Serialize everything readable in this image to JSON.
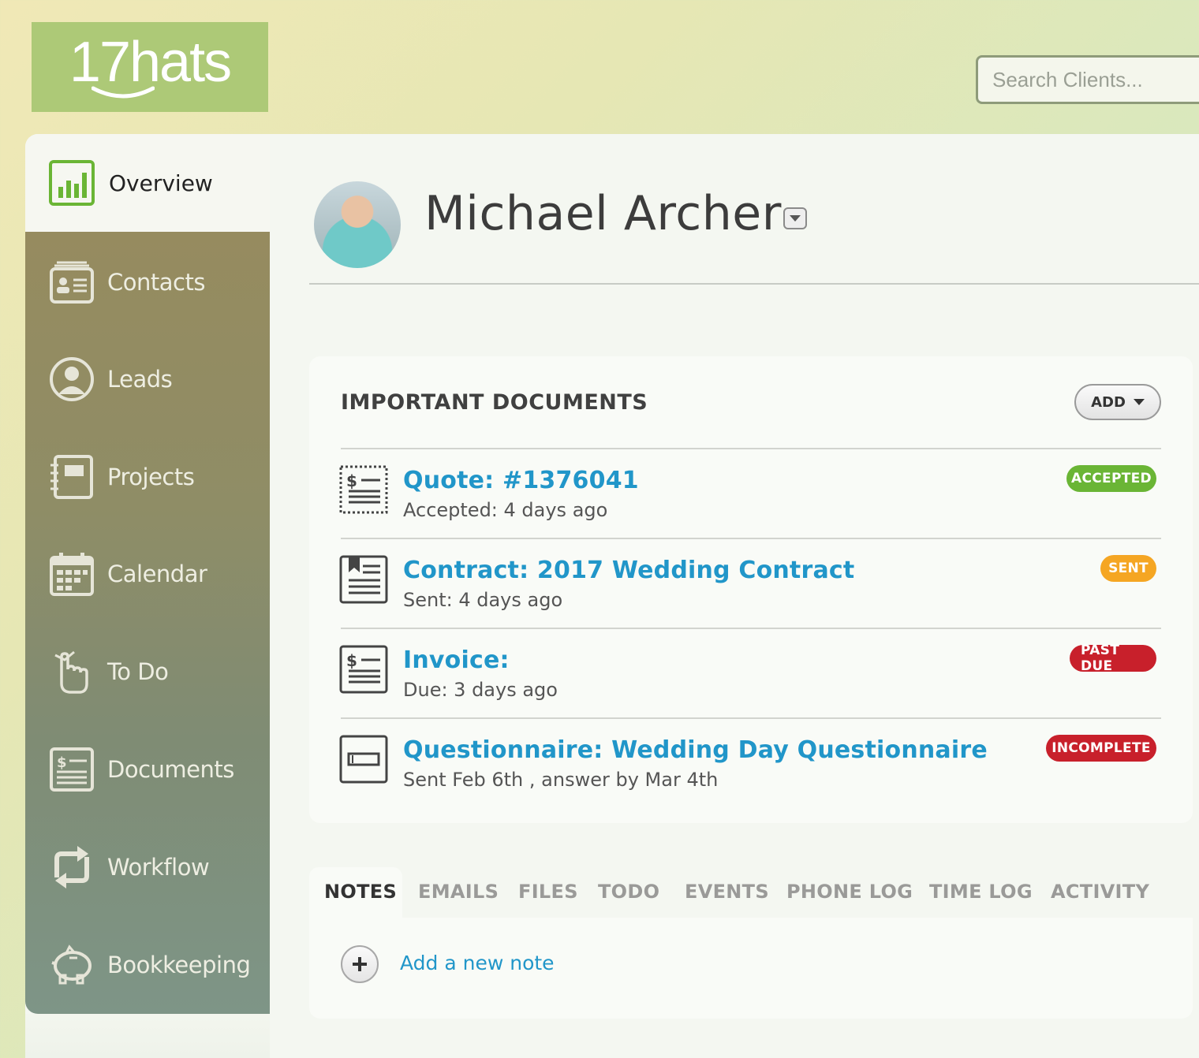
{
  "app": {
    "logo_text": "17hats"
  },
  "search": {
    "placeholder": "Search Clients..."
  },
  "sidebar": {
    "active": {
      "label": "Overview"
    },
    "items": [
      {
        "label": "Contacts",
        "icon": "contacts-icon"
      },
      {
        "label": "Leads",
        "icon": "leads-icon"
      },
      {
        "label": "Projects",
        "icon": "projects-icon"
      },
      {
        "label": "Calendar",
        "icon": "calendar-icon"
      },
      {
        "label": "To Do",
        "icon": "todo-icon"
      },
      {
        "label": "Documents",
        "icon": "documents-icon"
      },
      {
        "label": "Workflow",
        "icon": "workflow-icon"
      },
      {
        "label": "Bookkeeping",
        "icon": "bookkeeping-icon"
      }
    ]
  },
  "client": {
    "name": "Michael Archer"
  },
  "documents": {
    "title": "IMPORTANT DOCUMENTS",
    "add_label": "ADD",
    "rows": [
      {
        "title": "Quote: #1376041",
        "subtitle": "Accepted: 4 days ago",
        "status": "ACCEPTED",
        "status_color": "#6ab535"
      },
      {
        "title": "Contract: 2017 Wedding Contract",
        "subtitle": "Sent: 4 days ago",
        "status": "SENT",
        "status_color": "#f5a623"
      },
      {
        "title": "Invoice:",
        "subtitle": "Due: 3 days ago",
        "status": "PAST DUE",
        "status_color": "#c8202b"
      },
      {
        "title": "Questionnaire: Wedding Day Questionnaire",
        "subtitle": "Sent Feb 6th , answer by Mar 4th",
        "status": "INCOMPLETE",
        "status_color": "#c8202b"
      }
    ]
  },
  "tabs": [
    "NOTES",
    "EMAILS",
    "FILES",
    "TODO",
    "EVENTS",
    "PHONE LOG",
    "TIME LOG",
    "ACTIVITY"
  ],
  "notes": {
    "add_label": "Add a new note"
  },
  "colors": {
    "accent": "#2196c9",
    "logo_bg": "#adc977",
    "overview_icon": "#6ab535"
  }
}
